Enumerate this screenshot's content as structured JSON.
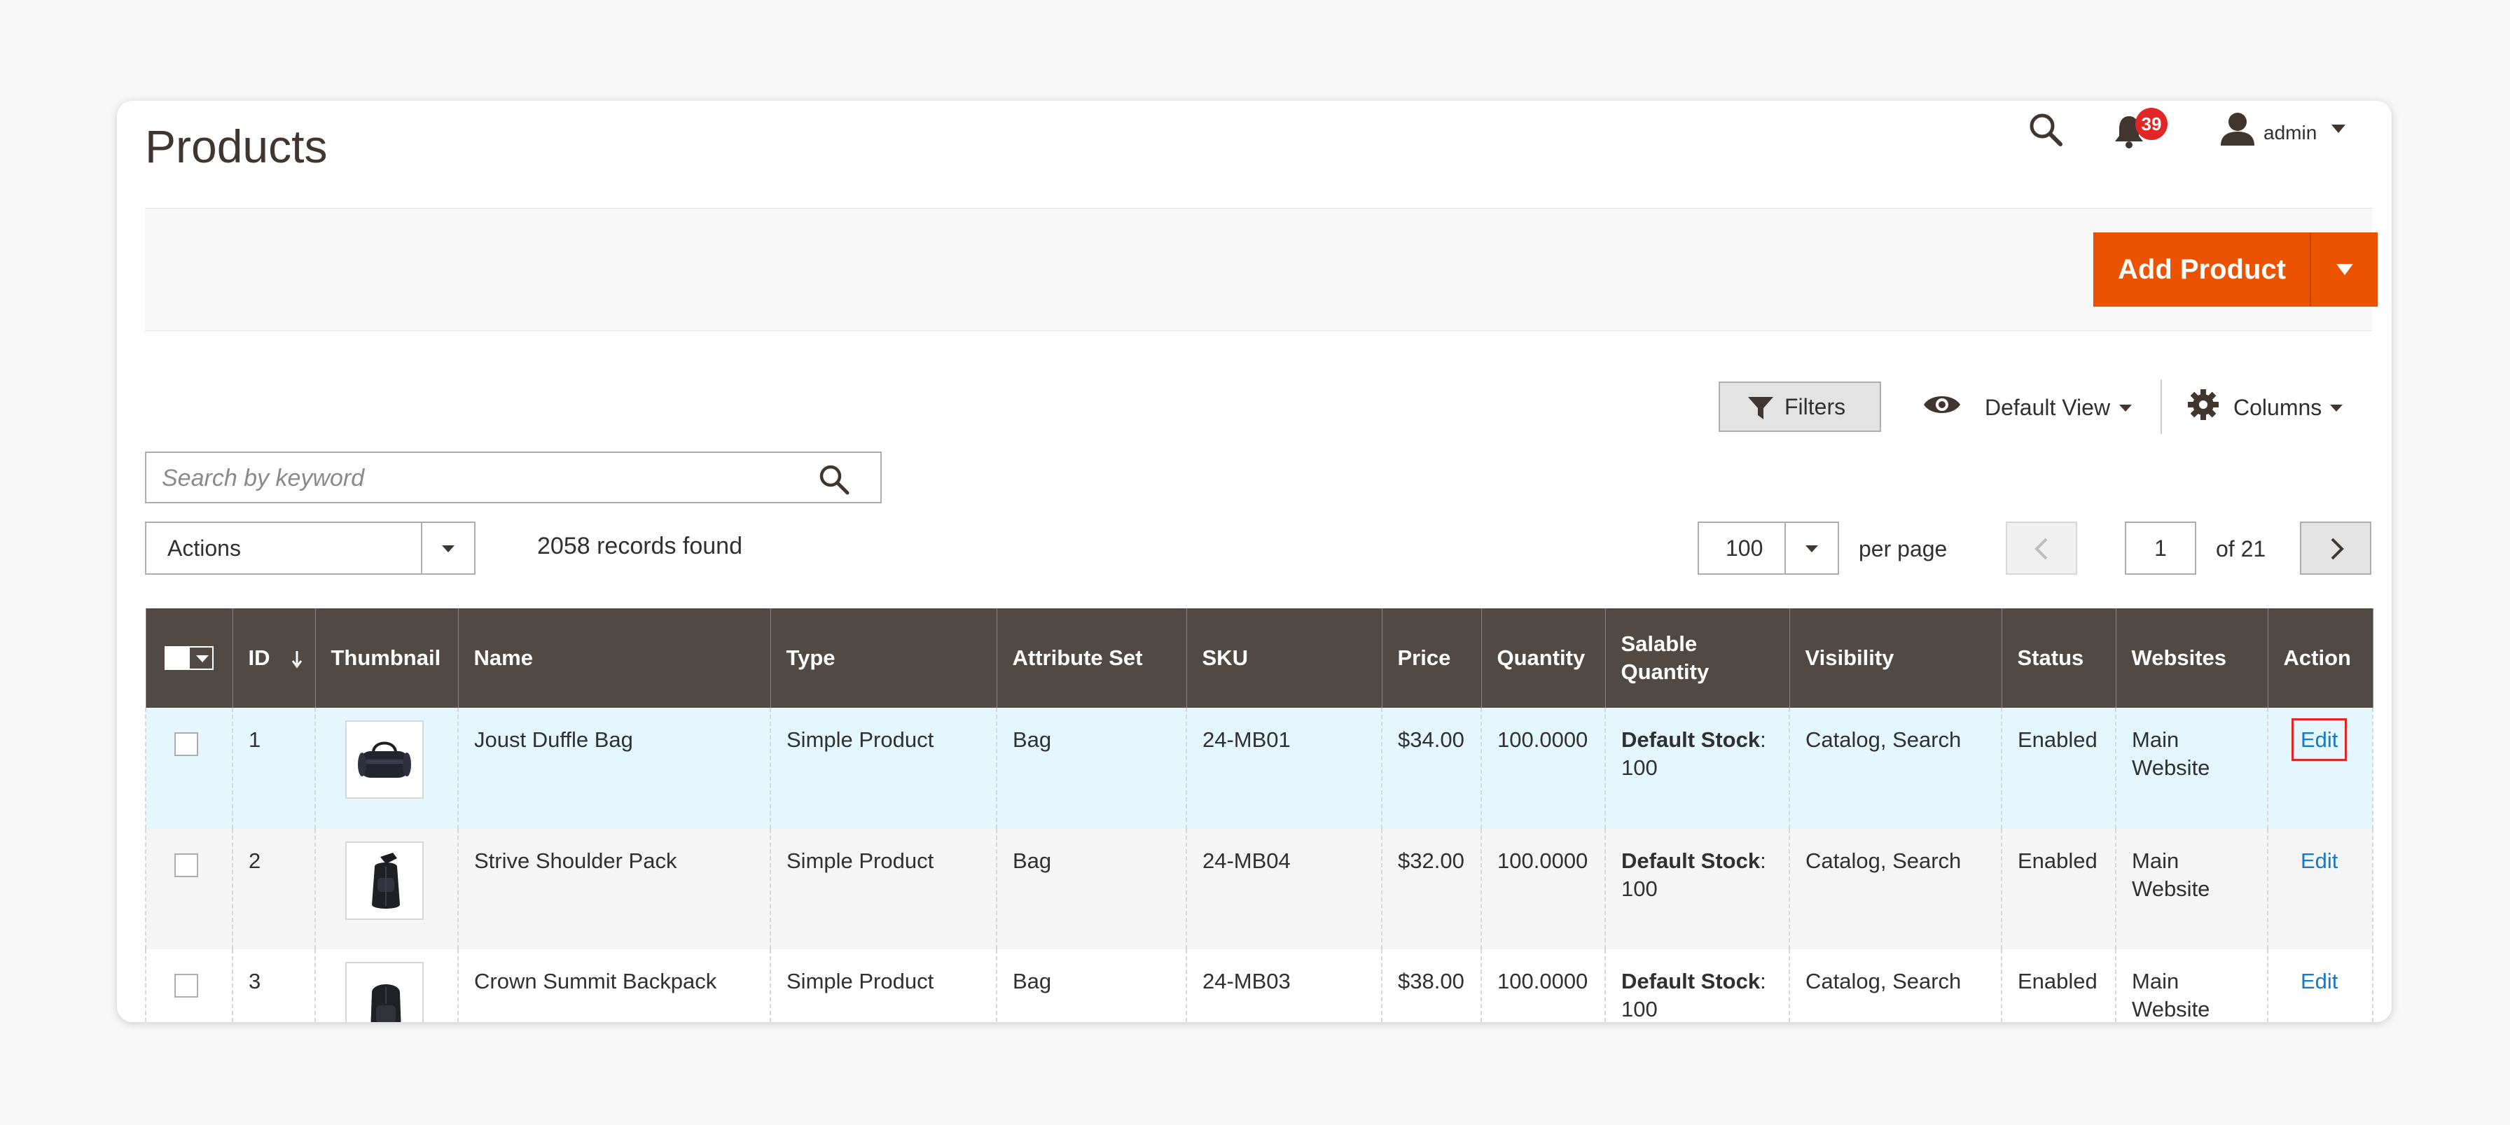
{
  "header": {
    "title": "Products",
    "notification_count": "39",
    "user_name": "admin"
  },
  "page_actions": {
    "add_product_label": "Add Product"
  },
  "toolbar": {
    "filters_label": "Filters",
    "view_label": "Default View",
    "columns_label": "Columns",
    "search_placeholder": "Search by keyword",
    "actions_label": "Actions",
    "records_found": "2058 records found",
    "per_page_value": "100",
    "per_page_label": "per page",
    "current_page": "1",
    "of_pages": "of 21"
  },
  "grid": {
    "columns": [
      "ID",
      "Thumbnail",
      "Name",
      "Type",
      "Attribute Set",
      "SKU",
      "Price",
      "Quantity",
      "Salable Quantity",
      "Visibility",
      "Status",
      "Websites",
      "Action"
    ],
    "rows": [
      {
        "id": "1",
        "name": "Joust Duffle Bag",
        "type": "Simple Product",
        "attribute_set": "Bag",
        "sku": "24-MB01",
        "price": "$34.00",
        "quantity": "100.0000",
        "salable_label": "Default Stock",
        "salable_value": "100",
        "visibility": "Catalog, Search",
        "status": "Enabled",
        "websites": "Main Website",
        "action": "Edit"
      },
      {
        "id": "2",
        "name": "Strive Shoulder Pack",
        "type": "Simple Product",
        "attribute_set": "Bag",
        "sku": "24-MB04",
        "price": "$32.00",
        "quantity": "100.0000",
        "salable_label": "Default Stock",
        "salable_value": "100",
        "visibility": "Catalog, Search",
        "status": "Enabled",
        "websites": "Main Website",
        "action": "Edit"
      },
      {
        "id": "3",
        "name": "Crown Summit Backpack",
        "type": "Simple Product",
        "attribute_set": "Bag",
        "sku": "24-MB03",
        "price": "$38.00",
        "quantity": "100.0000",
        "salable_label": "Default Stock",
        "salable_value": "100",
        "visibility": "Catalog, Search",
        "status": "Enabled",
        "websites": "Main Website",
        "action": "Edit"
      }
    ]
  },
  "colors": {
    "accent": "#eb5202",
    "header_bg": "#514943",
    "link": "#1979c3",
    "badge": "#e22626",
    "highlight_row": "#e5f7fe"
  }
}
